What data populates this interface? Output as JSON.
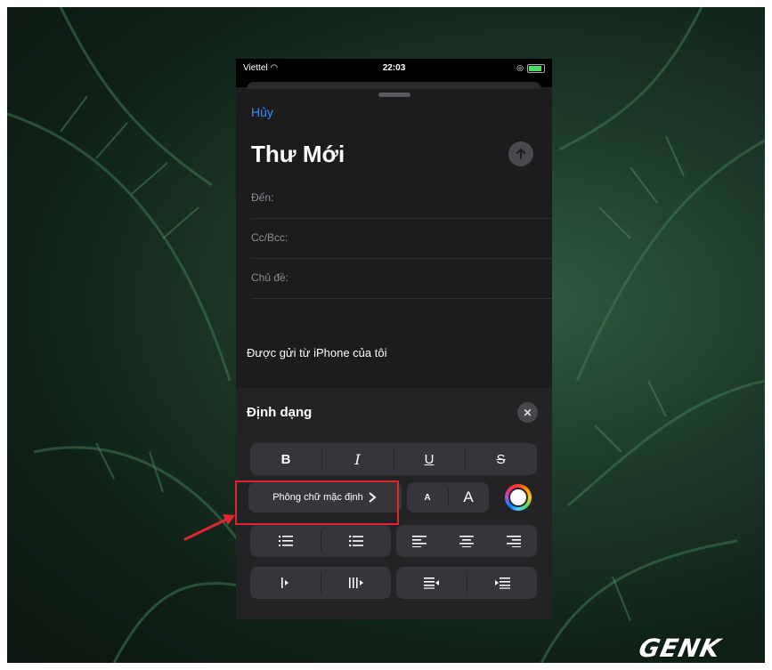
{
  "status_bar": {
    "carrier": "Viettel",
    "time": "22:03"
  },
  "compose": {
    "cancel_label": "Hủy",
    "title": "Thư Mới",
    "fields": {
      "to": "Đến:",
      "cc_bcc": "Cc/Bcc:",
      "subject": "Chủ đề:"
    },
    "signature": "Được gửi từ iPhone của tôi"
  },
  "format_panel": {
    "title": "Định dạng",
    "style_buttons": {
      "bold": "B",
      "italic": "I",
      "underline": "U",
      "strikethrough": "S"
    },
    "font_button": "Phông chữ mặc định",
    "size_small": "A",
    "size_large": "A",
    "accent_color": "#e0272f",
    "link_color": "#3a8dff"
  },
  "watermark": {
    "logo": "GENK"
  },
  "icons": [
    "wifi-icon",
    "alarm-icon",
    "battery-icon",
    "send-arrow-icon",
    "close-icon",
    "chevron-right-icon",
    "color-wheel-icon",
    "numbered-list-icon",
    "bullet-list-icon",
    "align-left-icon",
    "align-center-icon",
    "align-right-icon",
    "outdent-icon",
    "indent-icon",
    "quote-decrease-icon",
    "quote-increase-icon",
    "red-arrow-annotation"
  ]
}
